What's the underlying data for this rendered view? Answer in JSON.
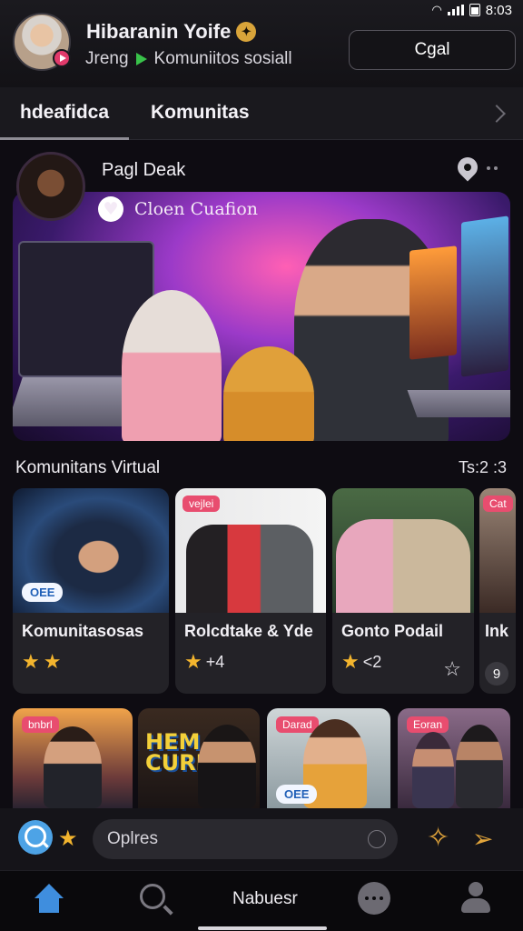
{
  "status_bar": {
    "time": "8:03"
  },
  "header": {
    "name": "Hibaranin Yoife",
    "subtitle_left": "Jreng",
    "subtitle_right": "Komuniitos sosiall",
    "action_button": "Cgal"
  },
  "tabs": [
    {
      "label": "hdeafidca",
      "active": true
    },
    {
      "label": "Komunitas",
      "active": false
    }
  ],
  "feature": {
    "title": "Pagl Deak",
    "banner_caption": "Cloen Cuafion"
  },
  "section": {
    "title": "Komunitans Virtual",
    "count": "Ts:2 :3"
  },
  "cards": [
    {
      "name": "Komunitasosas",
      "tag": "OEE",
      "rating_extra": ""
    },
    {
      "name": "Rolcdtake & Yde",
      "badge": "vejlei",
      "rating_extra": "+4"
    },
    {
      "name": "Gonto Podail",
      "rating_extra": "<2"
    },
    {
      "name": "Ink",
      "badge": "Cat",
      "count": "9"
    }
  ],
  "row2": [
    {
      "badge": "bnbrl"
    },
    {
      "poster_text": "HEM CURIK"
    },
    {
      "badge": "Darad",
      "tag": "OEE"
    },
    {
      "badge": "Eoran"
    }
  ],
  "search": {
    "placeholder": "Oplres"
  },
  "bottom_nav": {
    "center_label": "Nabuesr"
  },
  "colors": {
    "accent_blue": "#3f8ede",
    "star_gold": "#f3b52e",
    "badge_pink": "#e84d6f"
  }
}
